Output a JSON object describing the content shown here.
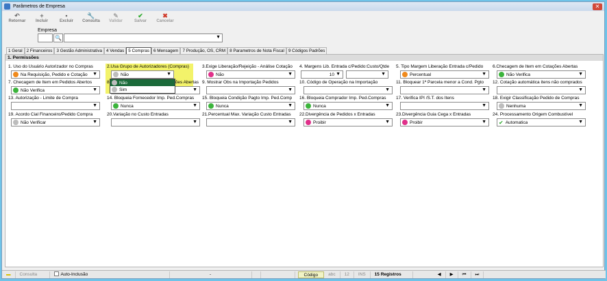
{
  "window": {
    "title": "Parâmetros de Empresa",
    "close_label": "✕"
  },
  "toolbar": [
    {
      "id": "retornar",
      "label": "Retornar",
      "icon": "↶"
    },
    {
      "id": "incluir",
      "label": "Incluir",
      "icon": "+"
    },
    {
      "id": "excluir",
      "label": "Excluir",
      "icon": "▪"
    },
    {
      "id": "consulta",
      "label": "Consulta",
      "icon": "🔧"
    },
    {
      "id": "validar",
      "label": "Validar",
      "icon": "✎"
    },
    {
      "id": "salvar",
      "label": "Salvar",
      "icon": "✔"
    },
    {
      "id": "cancelar",
      "label": "Cancelar",
      "icon": "✖"
    }
  ],
  "empresa": {
    "label": "Empresa",
    "search_icon": "🔍"
  },
  "tabs": [
    "1 Geral",
    "2 Financeiros",
    "3 Gestão Administrativa",
    "4 Vendas",
    "5 Compras",
    "6 Mensagem",
    "7 Produção, OS, CRM",
    "8 Parametros de Nota Fiscal",
    "9 Códigos Padrões"
  ],
  "active_tab": "5 Compras",
  "group_title": "1. Permissões",
  "colors": {
    "green": "#3cb43c",
    "orange": "#f08a1c",
    "pink": "#e0308a",
    "grey": "#bdbdbd",
    "check": "#2aa82a"
  },
  "fields": [
    {
      "label": "1. Uso do Usuário Autorizador no Compras",
      "value": "Na Requisição, Pedido e Cotação",
      "dot": "orange"
    },
    {
      "label": "2.Usa Grupo de Autorizadores (Compras)",
      "value": "Não",
      "dot": "grey"
    },
    {
      "label": "3.Exige Liberação/Rejeição - Análise Cotação",
      "value": "Não",
      "dot": "pink"
    },
    {
      "label": "4. Margens Lib. Entrada c/Pedido:Custo/Qtde",
      "value": "10",
      "value2": ""
    },
    {
      "label": "5. Tipo Margem Liberação Entrada c/Pedido",
      "value": "Percentual",
      "dot": "orange"
    },
    {
      "label": "6.Checagem de Item em Cotações Abertas",
      "value": "Não Verifica",
      "dot": "green"
    },
    {
      "label": "7. Checagem de Item em Pedidos Abertos",
      "value": "Não Verifica",
      "dot": "green"
    },
    {
      "label": "8. Exige Liberação/Rejeição Cotações Abertas",
      "value": ""
    },
    {
      "label": "9. Mostrar Obs na Importação Pedidos",
      "value": ""
    },
    {
      "label": "10. Código de Operação na Importação",
      "value": ""
    },
    {
      "label": "11. Bloquear 1ª Parcela menor a Cond. Pgto",
      "value": ""
    },
    {
      "label": "12. Cotação automática itens não comprados",
      "value": ""
    },
    {
      "label": "13. Autorização - Limite de Compra",
      "value": ""
    },
    {
      "label": "14. Bloqueia Fornecedor Imp. Ped.Compras",
      "value": "Nunca",
      "dot": "green"
    },
    {
      "label": "15. Bloqueia Condição Pagto Imp. Ped.Comp",
      "value": "Nunca",
      "dot": "green"
    },
    {
      "label": "16. Bloqueia Comprador  Imp. Ped.Compras",
      "value": "Nunca",
      "dot": "green"
    },
    {
      "label": "17. Verifica IPI /S.T. dos Itens",
      "value": ""
    },
    {
      "label": "18. Exigir Classificação Pedido de Compras",
      "value": "Nenhuma",
      "dot": "grey"
    },
    {
      "label": "19. Acordo Cial Financeiro/Pedido Compra",
      "value": "Não Verificar",
      "dot": "grey"
    },
    {
      "label": "20.Variação no Custo Entradas",
      "value": ""
    },
    {
      "label": "21.Percentual Max. Variação Custo Entradas",
      "value": ""
    },
    {
      "label": "22.Divergência de Pedidos x Entradas",
      "value": "Proibir",
      "dot": "pink"
    },
    {
      "label": "23.Divergência Guia Cega x Entradas",
      "value": "Proibir",
      "dot": "pink"
    },
    {
      "label": "24. Processamento Origem Combustível",
      "value": "Automatica",
      "dot": "check"
    }
  ],
  "dropdown_options": [
    {
      "label": "Não",
      "dot": "grey",
      "selected": true
    },
    {
      "label": "Sim",
      "dot": "grey",
      "selected": false
    }
  ],
  "status": {
    "consulta": "Consulta",
    "auto_inclusao": "Auto-Inclusão",
    "dash": "-",
    "codigo": "Código",
    "abc": "abc",
    "num": "12",
    "ins": "INS",
    "registros": "15 Registros"
  }
}
